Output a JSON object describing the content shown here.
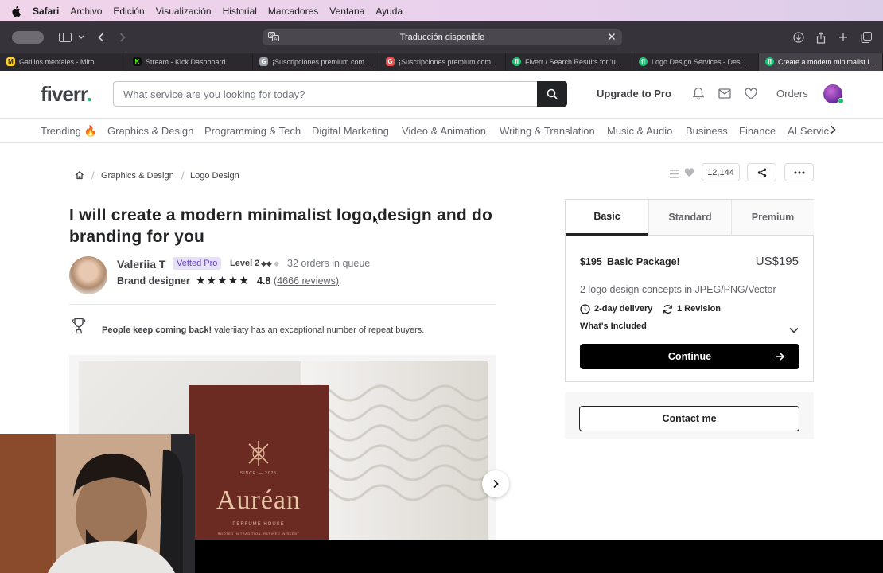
{
  "menubar": {
    "app": "Safari",
    "items": [
      "Archivo",
      "Edición",
      "Visualización",
      "Historial",
      "Marcadores",
      "Ventana",
      "Ayuda"
    ]
  },
  "toolbar": {
    "address_text": "Traducción disponible"
  },
  "tabs": [
    {
      "label": "Gatillos mentales - Miro",
      "color": "#ffd02f",
      "glyph": "M"
    },
    {
      "label": "Stream - Kick Dashboard",
      "color": "#53fc18",
      "glyph": "K"
    },
    {
      "label": "¡Suscripciones premium com...",
      "color": "#9aa0a6",
      "glyph": "G"
    },
    {
      "label": "¡Suscripciones premium com...",
      "color": "#e0524a",
      "glyph": "G"
    },
    {
      "label": "Fiverr / Search Results for 'u...",
      "color": "#1dbf73",
      "glyph": "fi"
    },
    {
      "label": "Logo Design Services - Desi...",
      "color": "#1dbf73",
      "glyph": "fi"
    },
    {
      "label": "Create a modern minimalist l...",
      "color": "#1dbf73",
      "glyph": "fi"
    }
  ],
  "header": {
    "logo": "fiverr",
    "logo_dot": ".",
    "search_placeholder": "What service are you looking for today?",
    "upgrade": "Upgrade to Pro",
    "orders": "Orders"
  },
  "categories": [
    "Trending 🔥",
    "Graphics & Design",
    "Programming & Tech",
    "Digital Marketing",
    "Video & Animation",
    "Writing & Translation",
    "Music & Audio",
    "Business",
    "Finance",
    "AI Servic"
  ],
  "breadcrumb": [
    "Graphics & Design",
    "Logo Design"
  ],
  "save_count": "12,144",
  "gig": {
    "title": "I will create a modern minimalist logo design and do branding for you",
    "seller_name": "Valeriia T",
    "vetted": "Vetted Pro",
    "level": "Level 2",
    "level_diamonds": "◆◆",
    "queue": "32 orders in queue",
    "role": "Brand designer",
    "stars": "★★★★★",
    "rating": "4.8",
    "reviews": "(4666 reviews)",
    "repeat_bold": "People keep coming back!",
    "repeat_text": " valeriiaty has an exceptional number of repeat buyers."
  },
  "image": {
    "brand": "Auréan",
    "since": "SINCE — 2025",
    "sub": "PERFUME HOUSE",
    "tagline": "ROOTED IN TRADITION. REFINED IN SCENT"
  },
  "package": {
    "tabs": [
      "Basic",
      "Standard",
      "Premium"
    ],
    "price_label": "$195",
    "name": "Basic Package!",
    "price": "US$195",
    "description": "2 logo design concepts in JPEG/PNG/Vector",
    "delivery": "2-day delivery",
    "revisions": "1 Revision",
    "included": "What's Included",
    "continue": "Continue",
    "contact": "Contact me"
  }
}
